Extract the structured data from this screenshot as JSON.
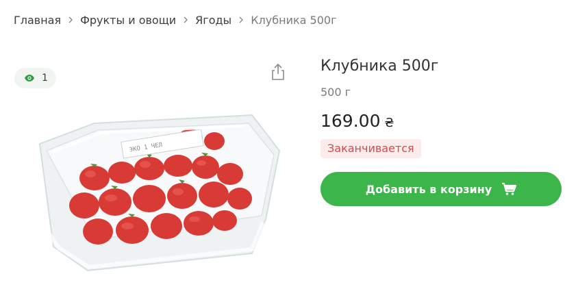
{
  "breadcrumb": {
    "items": [
      {
        "label": "Главная"
      },
      {
        "label": "Фрукты и овощи"
      },
      {
        "label": "Ягоды"
      },
      {
        "label": "Клубника 500г"
      }
    ],
    "separator_icon": "chevron-right-icon"
  },
  "media": {
    "views_count": "1",
    "views_icon": "eye-icon",
    "share_icon": "share-icon",
    "image": {
      "description_icon": "strawberry-punnet-image",
      "label_text": "ЭКО 1 ЧЕЛ"
    }
  },
  "product": {
    "title": "Клубника 500г",
    "weight": "500 г",
    "price": "169.00",
    "currency": "₴",
    "stock_status": "Заканчивается"
  },
  "actions": {
    "add_to_cart_label": "Добавить в корзину",
    "cart_icon": "cart-icon"
  },
  "colors": {
    "accent_green": "#3cb54a",
    "views_icon_green": "#2e9e46",
    "stock_warning_text": "#e04646",
    "stock_warning_bg": "#fdecec",
    "views_badge_bg": "#f1f5f2"
  }
}
